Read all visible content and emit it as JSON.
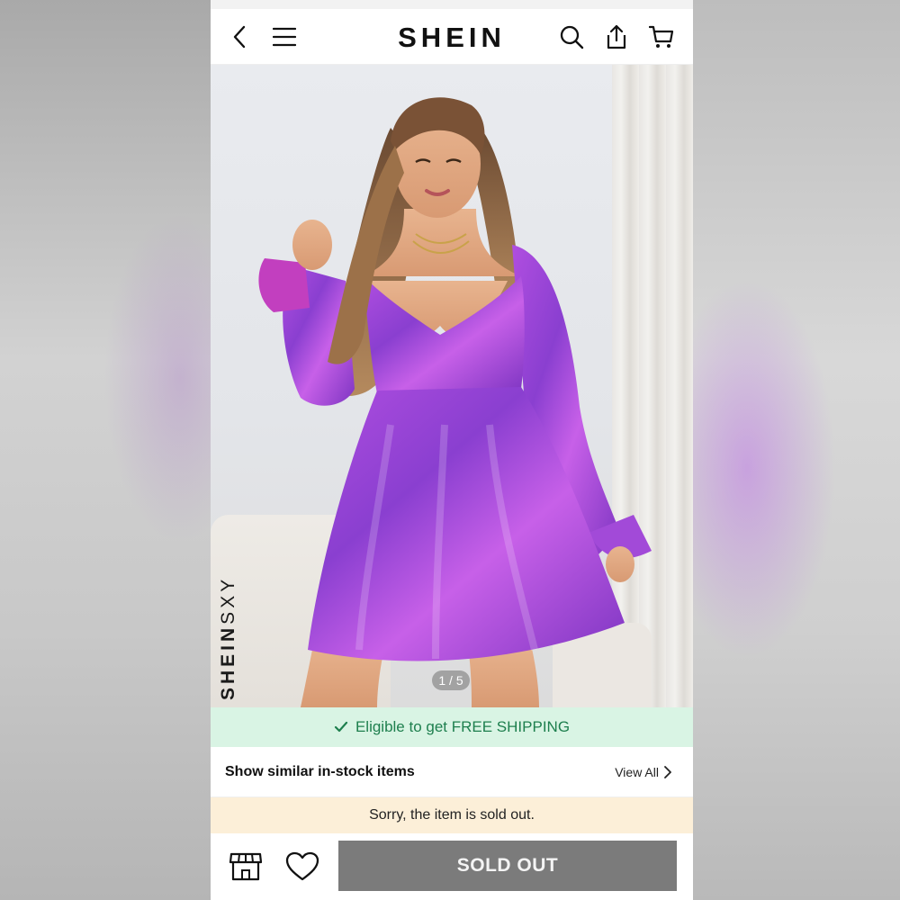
{
  "header": {
    "logo": "SHEIN",
    "icons": [
      "back-icon",
      "menu-icon",
      "search-icon",
      "share-icon",
      "cart-icon"
    ]
  },
  "hero": {
    "brand_bold": "SHEIN",
    "brand_light": "SXY",
    "pager": "1 / 5",
    "dress_color": "#9b3fd4"
  },
  "shipping": {
    "text": "Eligible to get FREE SHIPPING"
  },
  "similar": {
    "title": "Show similar in-stock items",
    "view_all": "View All"
  },
  "notice": {
    "text": "Sorry, the item is sold out."
  },
  "footer": {
    "sold_out_label": "SOLD OUT",
    "icons": [
      "store-icon",
      "heart-icon"
    ]
  }
}
